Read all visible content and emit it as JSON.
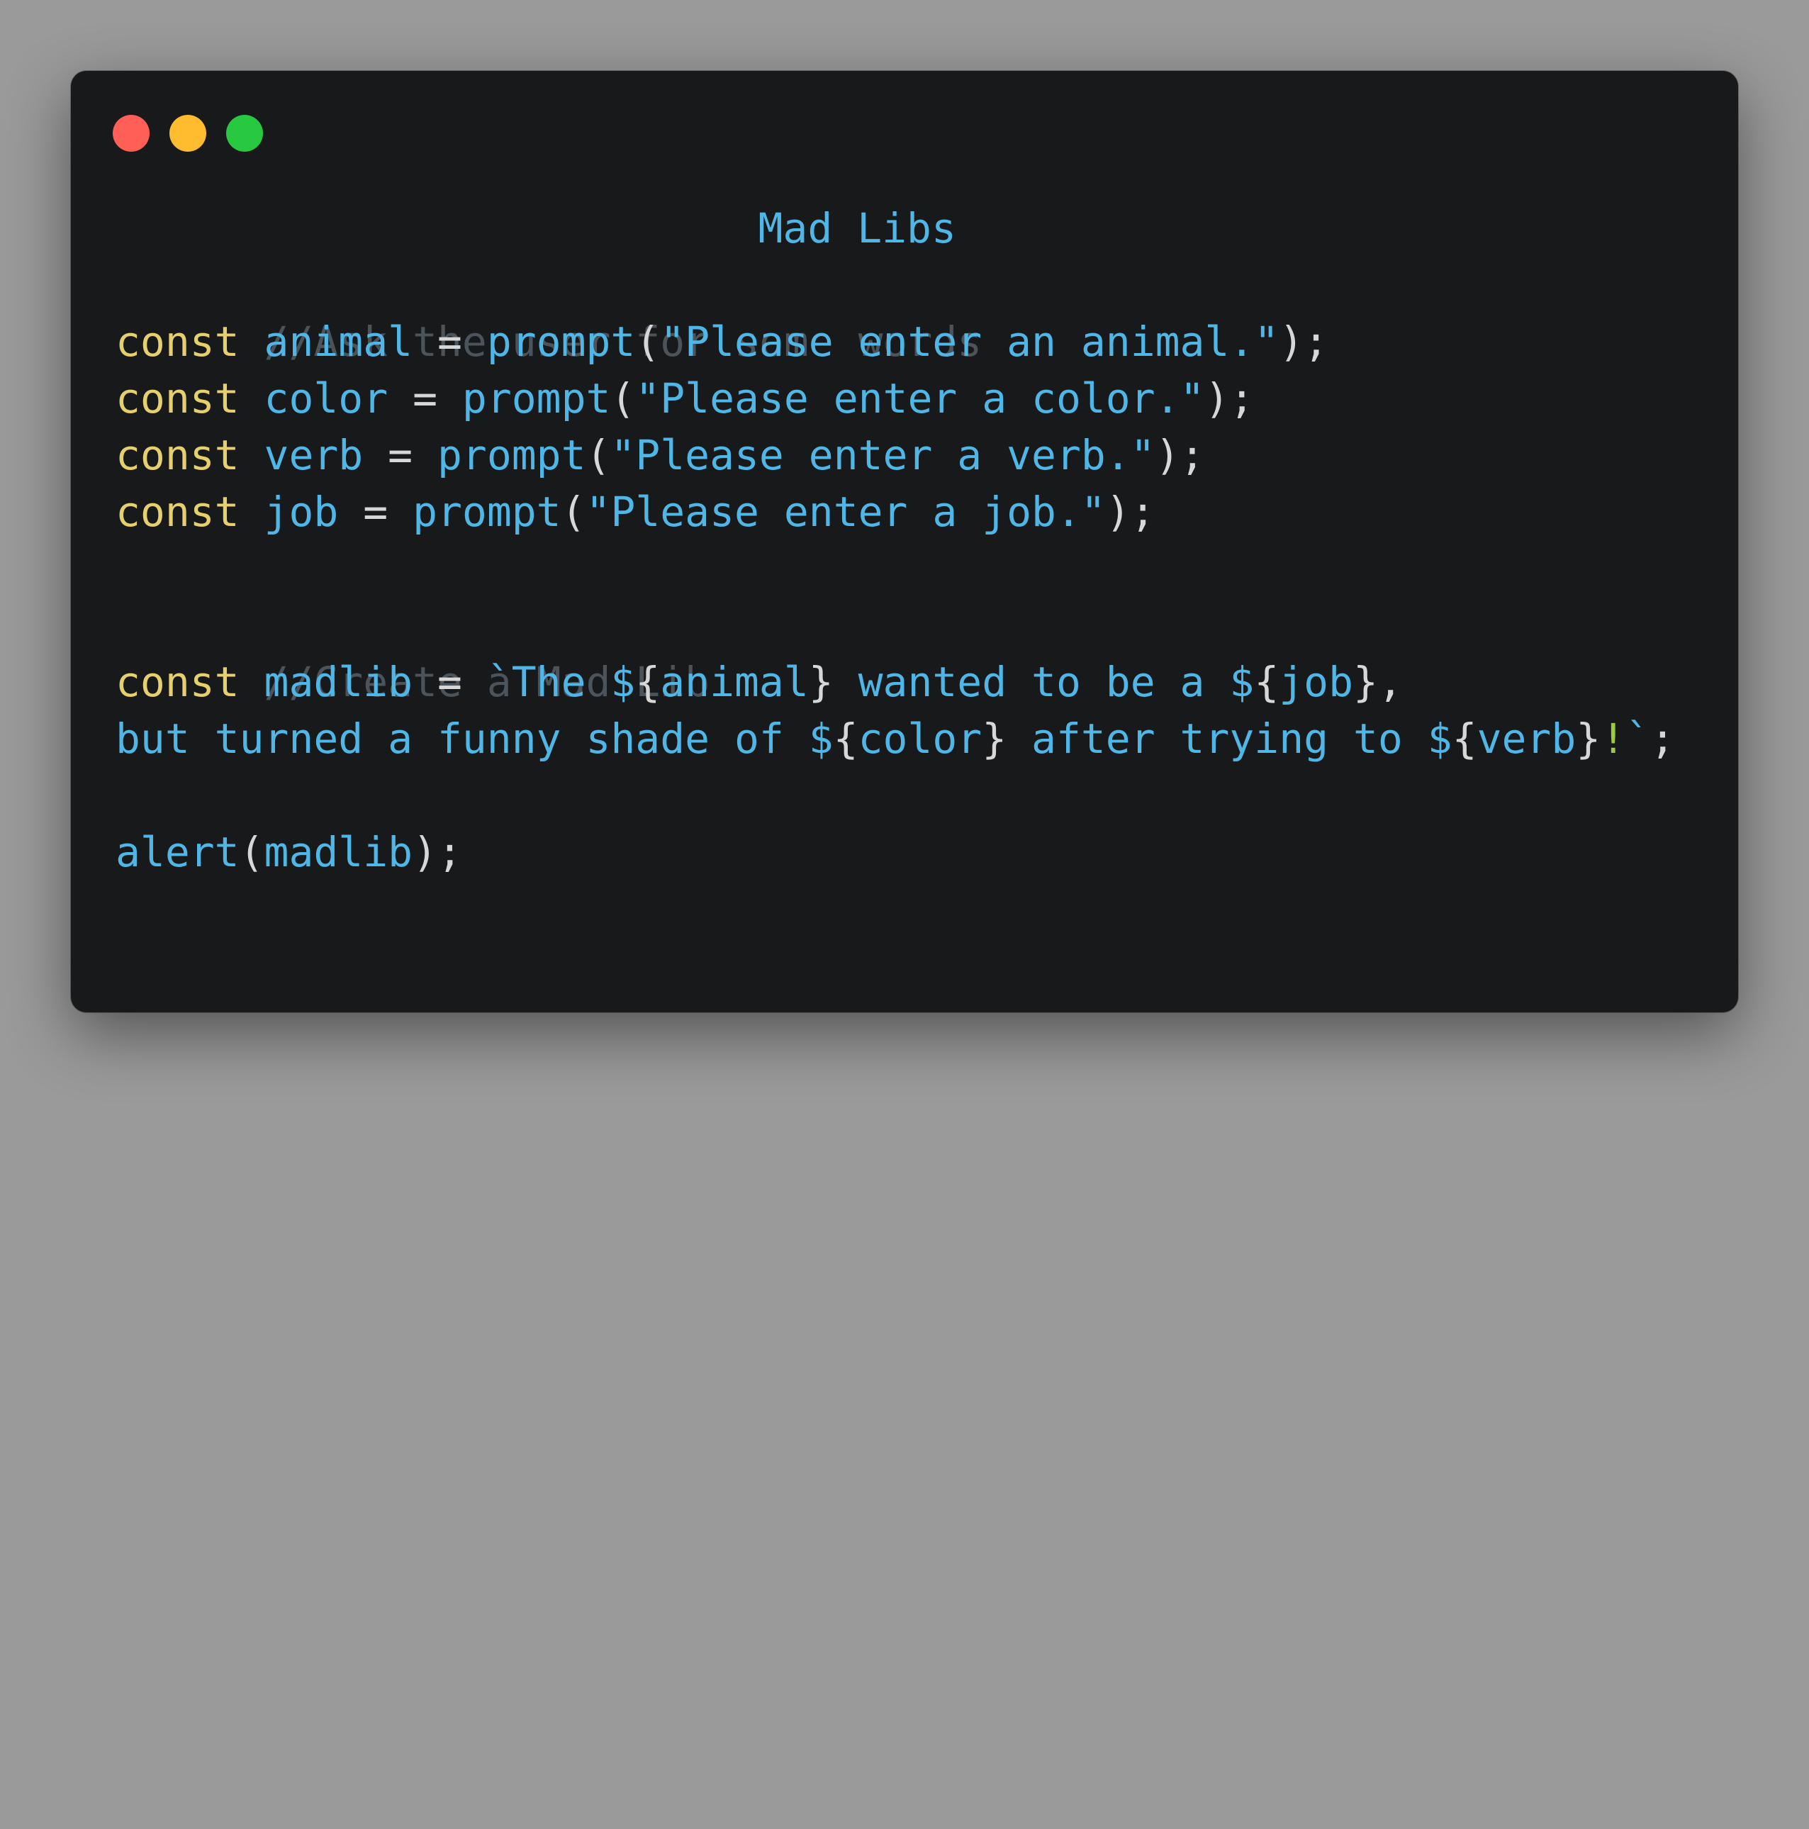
{
  "window": {
    "traffic_lights": [
      {
        "name": "close",
        "color": "#ff5f57"
      },
      {
        "name": "minimize",
        "color": "#febc2e"
      },
      {
        "name": "zoom",
        "color": "#28c840"
      }
    ]
  },
  "code": {
    "title": "Mad Libs",
    "comment1": "//Ask the user for some words",
    "kw": "const",
    "eq": "=",
    "prompt_fn": "prompt",
    "open_paren": "(",
    "close_paren_semi": ");",
    "var_animal": "animal",
    "str_animal": "\"Please enter an animal.\"",
    "var_color": "color",
    "str_color": "\"Please enter a color.\"",
    "var_verb": "verb",
    "str_verb": "\"Please enter a verb.\"",
    "var_job": "job",
    "str_job": "\"Please enter a job.\"",
    "comment2": "//Create a Mad Lib",
    "var_madlib": "madlib",
    "tmpl_line1_a": "`The $",
    "tmpl_lb": "{",
    "tmpl_rb": "}",
    "tmpl_animal": "animal",
    "tmpl_line1_b": " wanted to be a $",
    "tmpl_job": "job",
    "tmpl_line1_end": ",",
    "tmpl_line2_a": "but turned a funny shade of $",
    "tmpl_color": "color",
    "tmpl_line2_b": " after trying to $",
    "tmpl_verb": "verb",
    "tmpl_bang": "!",
    "tmpl_backtick": "`",
    "semi": ";",
    "alert_fn": "alert",
    "alert_arg": "madlib"
  }
}
